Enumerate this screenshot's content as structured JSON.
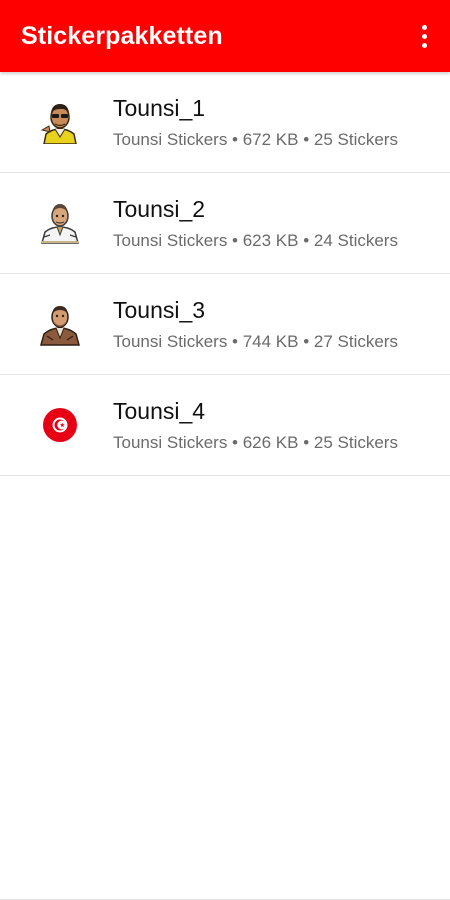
{
  "appbar": {
    "title": "Stickerpakketten",
    "background": "#ff0000"
  },
  "packs": [
    {
      "name": "Tounsi_1",
      "meta": "Tounsi Stickers • 672  KB • 25 Stickers",
      "icon": "sticker-man-yellow-shirt-icon"
    },
    {
      "name": "Tounsi_2",
      "meta": "Tounsi Stickers • 623  KB • 24 Stickers",
      "icon": "sticker-man-white-suit-icon"
    },
    {
      "name": "Tounsi_3",
      "meta": "Tounsi Stickers • 744  KB • 27 Stickers",
      "icon": "sticker-man-brown-jacket-icon"
    },
    {
      "name": "Tounsi_4",
      "meta": "Tounsi Stickers • 626  KB • 25 Stickers",
      "icon": "tunisia-flag-icon"
    }
  ]
}
